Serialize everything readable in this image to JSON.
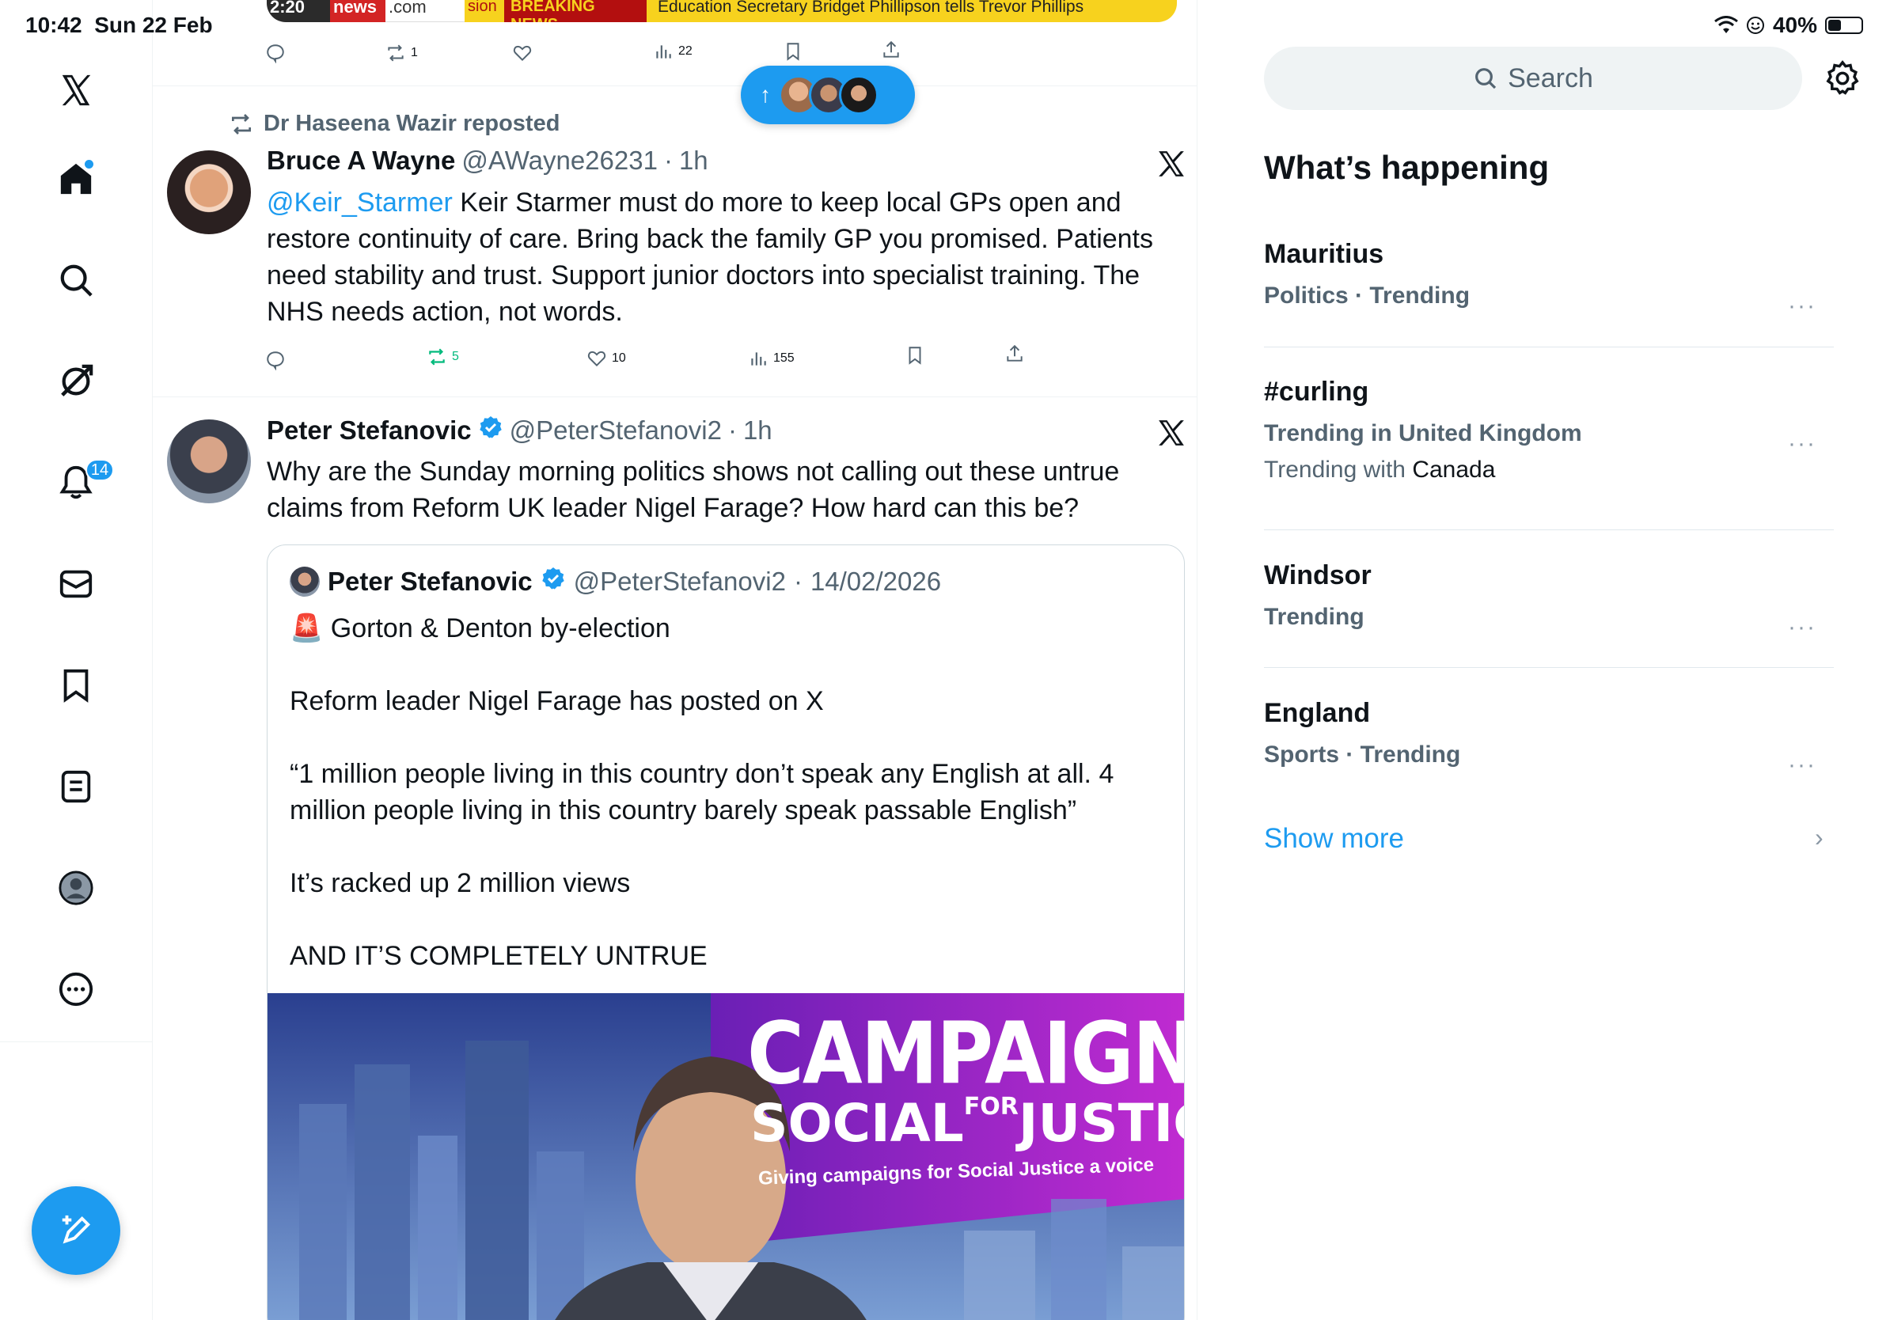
{
  "status_bar": {
    "time": "10:42",
    "date": "Sun 22 Feb",
    "battery": "40%",
    "battery_level": 0.4
  },
  "nav": {
    "notifications_badge": "14"
  },
  "feed": {
    "top_media": {
      "time_overlay": "2:20",
      "brand": "news",
      "brand_suffix": ".com",
      "tag": "sion",
      "breaking": "BREAKING NEWS",
      "ticker": "Education Secretary Bridget Phillipson tells Trevor Phillips"
    },
    "top_actions": {
      "reposts": "1",
      "views": "22"
    },
    "new_posts_arrow": "↑",
    "tweet1": {
      "repost_by": "Dr Haseena Wazir reposted",
      "name": "Bruce A Wayne",
      "handle": "@AWayne26231",
      "time": "1h",
      "mention": "@Keir_Starmer",
      "text": " Keir Starmer must do more to keep local GPs open and restore continuity of care. Bring back the family GP you promised. Patients need stability and trust. Support junior doctors into specialist training. The NHS needs action, not words.",
      "reposts": "5",
      "likes": "10",
      "views": "155"
    },
    "tweet2": {
      "name": "Peter Stefanovic",
      "handle": "@PeterStefanovi2",
      "time": "1h",
      "text": "Why are the Sunday morning politics shows not calling out these untrue claims from Reform UK leader Nigel Farage? How hard can this be?",
      "quote": {
        "name": "Peter Stefanovic",
        "handle": "@PeterStefanovi2",
        "date": "14/02/2026",
        "line1": "🚨 Gorton & Denton by-election",
        "line2": "Reform leader Nigel Farage has posted on X",
        "line3": "“1 million people living in this country don’t speak any English at all. 4 million people living in this country barely speak  passable English”",
        "line4": "It’s racked up 2 million views",
        "line5": "AND IT’S COMPLETELY UNTRUE",
        "image_title": "CAMPAIGN",
        "image_subtitle_a": "SOCIAL",
        "image_subtitle_for": "FOR",
        "image_subtitle_b": "JUSTICE",
        "image_tagline": "Giving campaigns for Social Justice a voice"
      }
    }
  },
  "sidebar": {
    "search_placeholder": "Search",
    "title": "What’s happening",
    "trends": [
      {
        "name": "Mauritius",
        "meta": "Politics · Trending"
      },
      {
        "name": "#curling",
        "meta": "Trending in United Kingdom",
        "with_prefix": "Trending with ",
        "with": "Canada"
      },
      {
        "name": "Windsor",
        "meta": "Trending"
      },
      {
        "name": "England",
        "meta": "Sports · Trending"
      }
    ],
    "more_glyph": "···",
    "show_more": "Show more",
    "show_more_chevron": "›"
  },
  "colors": {
    "accent": "#1d9bf0",
    "repost_green": "#00ba7c",
    "text": "#0f1419",
    "muted": "#536471"
  }
}
